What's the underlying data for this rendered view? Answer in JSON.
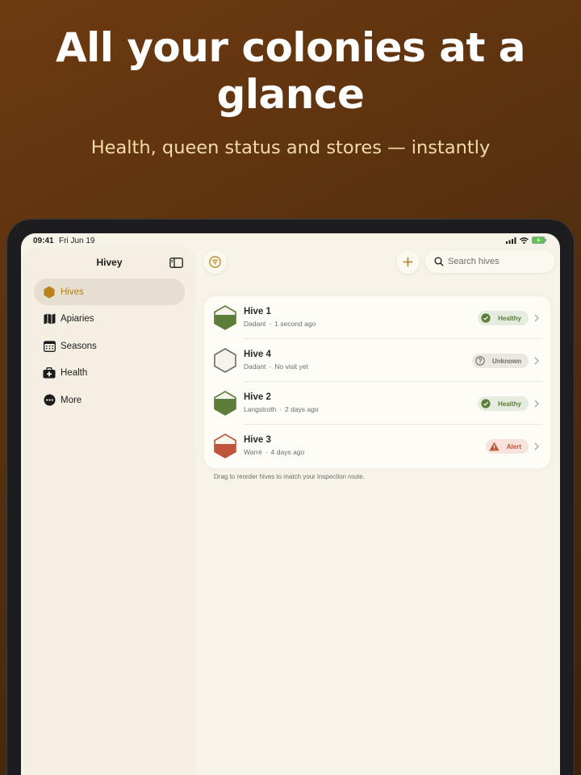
{
  "promo": {
    "headline": "All your colonies at a glance",
    "subhead": "Health, queen status and stores — instantly"
  },
  "status_bar": {
    "time": "09:41",
    "date": "Fri Jun 19"
  },
  "sidebar": {
    "title": "Hivey",
    "items": [
      {
        "label": "Hives",
        "icon": "hexagon-icon",
        "active": true
      },
      {
        "label": "Apiaries",
        "icon": "map-icon",
        "active": false
      },
      {
        "label": "Seasons",
        "icon": "calendar-icon",
        "active": false
      },
      {
        "label": "Health",
        "icon": "first-aid-kit-icon",
        "active": false
      },
      {
        "label": "More",
        "icon": "ellipsis-circle-icon",
        "active": false
      }
    ]
  },
  "toolbar": {
    "search_placeholder": "Search hives"
  },
  "hives": [
    {
      "name": "Hive 1",
      "type": "Dadant",
      "last_visit": "1 second ago",
      "status": "Healthy",
      "status_kind": "healthy"
    },
    {
      "name": "Hive 4",
      "type": "Dadant",
      "last_visit": "No visit yet",
      "status": "Unknown",
      "status_kind": "unknown"
    },
    {
      "name": "Hive 2",
      "type": "Langstroth",
      "last_visit": "2 days ago",
      "status": "Healthy",
      "status_kind": "healthy"
    },
    {
      "name": "Hive 3",
      "type": "Warré",
      "last_visit": "4 days ago",
      "status": "Alert",
      "status_kind": "alert"
    }
  ],
  "footnote": "Drag to reorder hives to match your inspection route.",
  "colors": {
    "accent": "#b9821a",
    "healthy": "#5d7d3b",
    "alert": "#c0543a",
    "background": "#f7f3e9"
  }
}
